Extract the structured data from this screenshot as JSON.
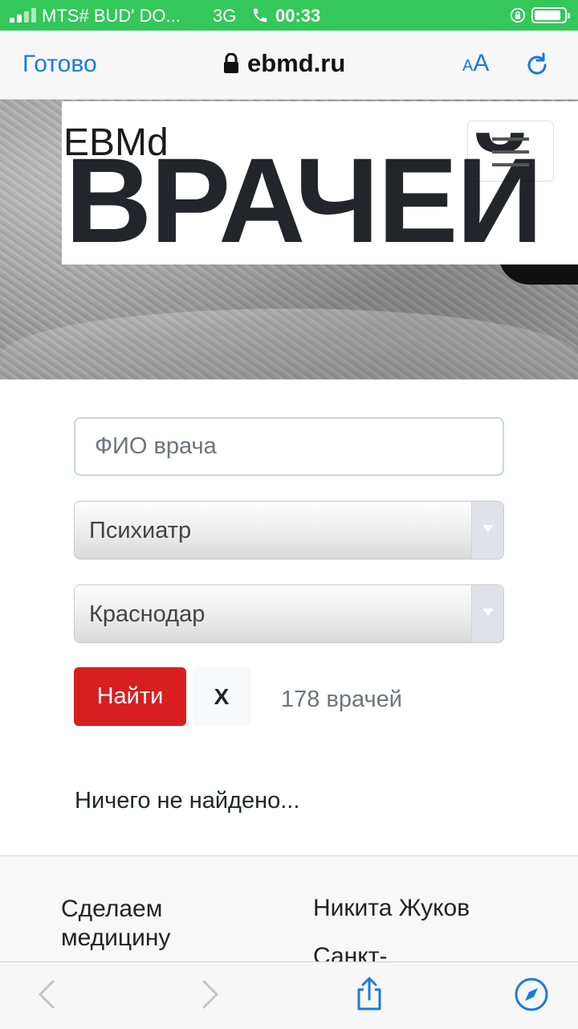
{
  "status_bar": {
    "carrier": "MTS# BUD' DO...",
    "network": "3G",
    "time": "00:33",
    "color": "#34c759"
  },
  "browser": {
    "done_label": "Готово",
    "url": "ebmd.ru",
    "text_size_small": "A",
    "text_size_large": "A",
    "accent_color": "#1a7ae0"
  },
  "hero": {
    "brand": "EBMd",
    "title_word": "ВРАЧЕЙ"
  },
  "search_form": {
    "name_placeholder": "ФИО врача",
    "specialty_value": "Психиатр",
    "city_value": "Краснодар",
    "find_label": "Найти",
    "clear_label": "X",
    "count_text": "178 врачей",
    "find_color": "#d71f1f"
  },
  "results": {
    "empty_text": "Ничего не найдено..."
  },
  "footer": {
    "slogan": "Сделаем медицину",
    "author": "Никита Жуков",
    "city_partial": "Санкт-"
  },
  "toolbar": {
    "icons": [
      "back-arrow-icon",
      "forward-arrow-icon",
      "share-icon",
      "safari-compass-icon"
    ]
  }
}
